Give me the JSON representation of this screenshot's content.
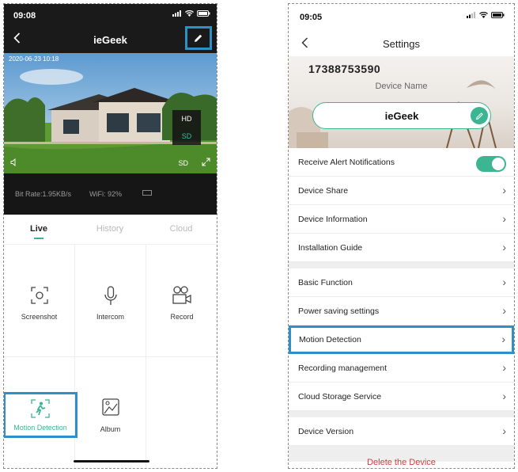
{
  "left": {
    "status": {
      "time": "09:08"
    },
    "nav": {
      "title": "ieGeek"
    },
    "video": {
      "timestamp": "2020-06-23 10:18",
      "quality_options": [
        "HD",
        "SD"
      ],
      "quality_selected": "SD",
      "quality_badge": "SD"
    },
    "info": {
      "bitrate": "Bit Rate:1.95KB/s",
      "wifi": "WiFi: 92%"
    },
    "tabs": [
      "Live",
      "History",
      "Cloud"
    ],
    "actions": [
      "Screenshot",
      "Intercom",
      "Record",
      "Motion Detection",
      "Album"
    ]
  },
  "right": {
    "status": {
      "time": "09:05"
    },
    "nav": {
      "title": "Settings"
    },
    "device": {
      "number": "17388753590",
      "name_label": "Device Name",
      "name": "ieGeek"
    },
    "rows": {
      "alerts": "Receive Alert Notifications",
      "share": "Device Share",
      "info": "Device Information",
      "install": "Installation Guide",
      "basic": "Basic Function",
      "power": "Power saving settings",
      "motion": "Motion Detection",
      "recording": "Recording management",
      "cloud": "Cloud Storage Service",
      "version": "Device Version"
    },
    "delete": "Delete the Device"
  },
  "colors": {
    "accent": "#3cb592",
    "highlight": "#2f8fc9",
    "danger": "#d23c3c"
  }
}
